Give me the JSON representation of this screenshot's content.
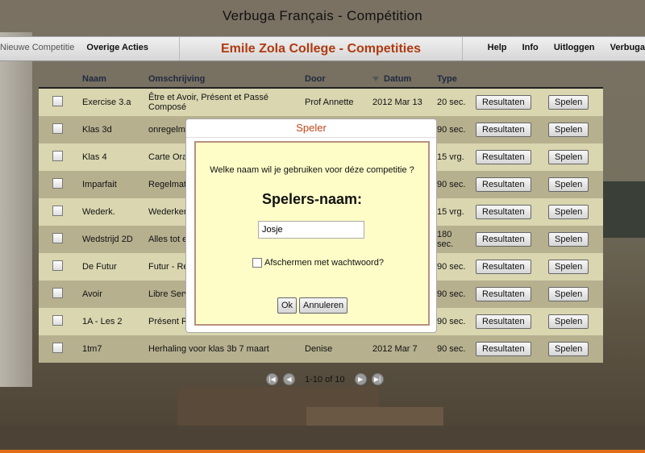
{
  "app_title": "Verbuga Français - Compétition",
  "nav": {
    "new_competition": "Nieuwe Competitie",
    "other_actions": "Overige Acties",
    "center_title": "Emile Zola College - Competities",
    "help": "Help",
    "info": "Info",
    "logout": "Uitloggen",
    "brand": "Verbuga"
  },
  "table": {
    "headers": [
      "Naam",
      "Omschrijving",
      "Door",
      "Datum",
      "Type"
    ],
    "sorted_column": "Datum",
    "rows": [
      {
        "naam": "Exercise 3.a",
        "omschrijving": "Être et Avoir, Présent et Passé Composé",
        "door": "Prof Annette",
        "datum": "2012 Mar 13",
        "type": "20 sec."
      },
      {
        "naam": "Klas 3d",
        "omschrijving": "onregelm",
        "door": "",
        "datum": "",
        "type": "90 sec."
      },
      {
        "naam": "Klas 4",
        "omschrijving": "Carte Ora",
        "door": "",
        "datum": "",
        "type": "15 vrg."
      },
      {
        "naam": "Imparfait",
        "omschrijving": "Regelmat",
        "door": "",
        "datum": "",
        "type": "90 sec."
      },
      {
        "naam": "Wederk.",
        "omschrijving": "Wederker Composé",
        "door": "",
        "datum": "",
        "type": "15 vrg."
      },
      {
        "naam": "Wedstrijd 2D",
        "omschrijving": "Alles tot e bonus !",
        "door": "",
        "datum": "",
        "type": "180 sec."
      },
      {
        "naam": "De Futur",
        "omschrijving": "Futur - Re",
        "door": "",
        "datum": "",
        "type": "90 sec."
      },
      {
        "naam": "Avoir",
        "omschrijving": "Libre Serv",
        "door": "",
        "datum": "",
        "type": "90 sec."
      },
      {
        "naam": "1A - Les 2",
        "omschrijving": "Présent R er,-ir",
        "door": "",
        "datum": "",
        "type": "90 sec."
      },
      {
        "naam": "1tm7",
        "omschrijving": "Herhaling voor klas 3b 7 maart",
        "door": "Denise",
        "datum": "2012 Mar 7",
        "type": "90 sec."
      }
    ],
    "results_label": "Resultaten",
    "play_label": "Spelen"
  },
  "pager": {
    "text": "1-10 of 10"
  },
  "dialog": {
    "title": "Speler",
    "question": "Welke naam wil je gebruiken voor déze competitie ?",
    "player_label": "Spelers-naam:",
    "name_value": "Josje",
    "password_label": "Afschermen met wachtwoord?",
    "ok": "Ok",
    "cancel": "Annuleren"
  }
}
